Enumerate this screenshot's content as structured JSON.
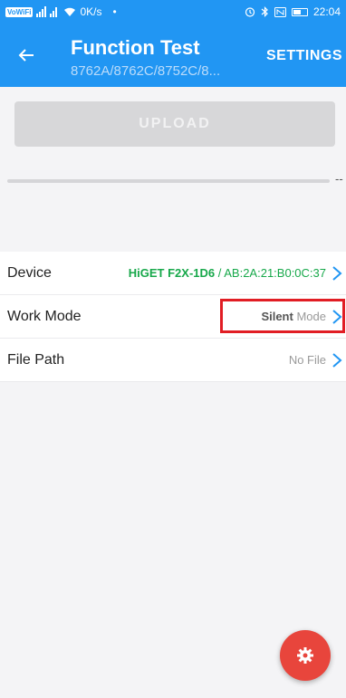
{
  "status_bar": {
    "left_text": "VoWiFi",
    "network_speed": "0K/s",
    "dot": "•",
    "time": "22:04",
    "icons": [
      "signal-icon",
      "wifi-icon",
      "alarm-icon",
      "bluetooth-icon",
      "nfc-icon",
      "battery-icon"
    ]
  },
  "toolbar": {
    "title": "Function Test",
    "subtitle": "8762A/8762C/8752C/8...",
    "settings_label": "SETTINGS",
    "color": "#2196f3"
  },
  "upload": {
    "label": "UPLOAD"
  },
  "progress": {
    "value": 0,
    "text": "--"
  },
  "list": {
    "device": {
      "label": "Device",
      "name": "HiGET F2X-1D6",
      "separator": " / ",
      "address": "AB:2A:21:B0:0C:37"
    },
    "work_mode": {
      "label": "Work Mode",
      "value_strong": "Silent",
      "value_weak": "Mode"
    },
    "file_path": {
      "label": "File Path",
      "value": "No File"
    }
  },
  "fab": {
    "icon": "gear-icon",
    "color": "#e8453c"
  }
}
